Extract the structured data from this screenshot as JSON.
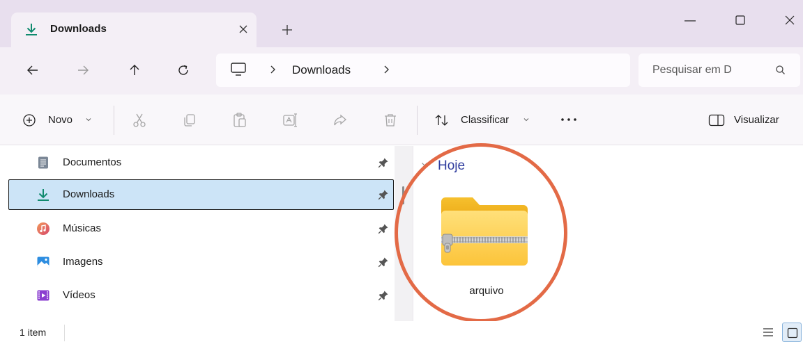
{
  "window": {
    "tab_title": "Downloads",
    "minimize_glyph": "—",
    "accent_color": "#0f8a6e"
  },
  "address": {
    "breadcrumb": [
      "Downloads"
    ],
    "search_placeholder": "Pesquisar em D"
  },
  "toolbar": {
    "new_label": "Novo",
    "sort_label": "Classificar",
    "preview_label": "Visualizar",
    "icons": [
      "cut-icon",
      "copy-icon",
      "paste-icon",
      "rename-icon",
      "share-icon",
      "delete-icon"
    ]
  },
  "sidebar": {
    "items": [
      {
        "label": "Documentos",
        "icon": "documents-icon",
        "pinned": true,
        "selected": false
      },
      {
        "label": "Downloads",
        "icon": "download-icon",
        "pinned": true,
        "selected": true
      },
      {
        "label": "Músicas",
        "icon": "music-icon",
        "pinned": true,
        "selected": false
      },
      {
        "label": "Imagens",
        "icon": "pictures-icon",
        "pinned": true,
        "selected": false
      },
      {
        "label": "Vídeos",
        "icon": "videos-icon",
        "pinned": true,
        "selected": false
      }
    ]
  },
  "content": {
    "group_label": "Hoje",
    "files": [
      {
        "name": "arquivo",
        "type": "zip-folder-icon"
      }
    ],
    "highlight_color": "#e36a46"
  },
  "status": {
    "item_count": "1 item"
  }
}
